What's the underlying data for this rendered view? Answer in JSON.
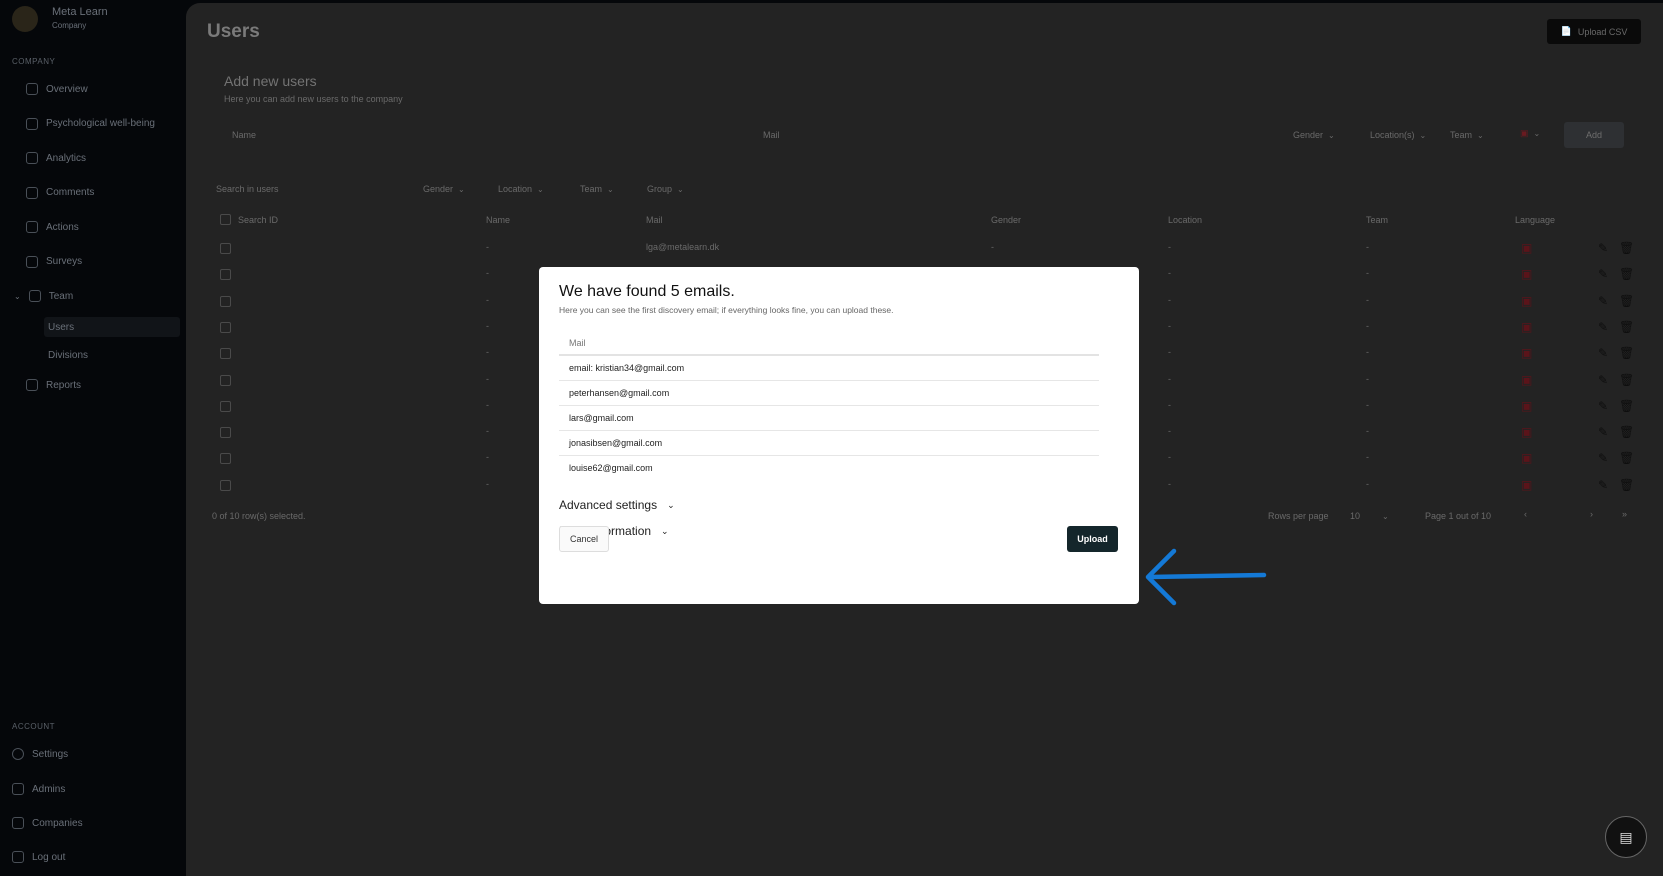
{
  "sidebar": {
    "brand": "Meta Learn",
    "brand_sub": "Company",
    "section1": "Company",
    "items": [
      {
        "label": "Overview",
        "icon": "grid-icon"
      },
      {
        "label": "Psychological well-being",
        "icon": "brain-icon"
      },
      {
        "label": "Analytics",
        "icon": "bar-chart-icon"
      },
      {
        "label": "Comments",
        "icon": "comment-icon"
      },
      {
        "label": "Actions",
        "icon": "check-circle-icon"
      },
      {
        "label": "Surveys",
        "icon": "survey-icon"
      },
      {
        "label": "Team",
        "icon": "team-icon"
      }
    ],
    "sub_items": [
      {
        "label": "Users"
      },
      {
        "label": "Divisions"
      }
    ],
    "reports": "Reports",
    "section2": "Account",
    "account_items": [
      {
        "label": "Settings"
      },
      {
        "label": "Admins"
      },
      {
        "label": "Companies"
      },
      {
        "label": "Log out"
      }
    ]
  },
  "page": {
    "title": "Users",
    "upload_csv": "Upload CSV",
    "add_title": "Add new users",
    "add_sub": "Here you can add new users to the company",
    "name_placeholder": "Name",
    "mail_placeholder": "Mail",
    "gender": "Gender",
    "locations": "Location(s)",
    "team": "Team",
    "add_button": "Add",
    "search_placeholder": "Search in users",
    "filters": [
      "Gender",
      "Location",
      "Team",
      "Group"
    ],
    "columns": [
      "Search ID",
      "Name",
      "Mail",
      "Gender",
      "Location",
      "Team",
      "Language"
    ],
    "first_mail": "lga@metalearn.dk",
    "selected": "0 of 10 row(s) selected.",
    "rows_per_page": "Rows per page",
    "rows_value": "10",
    "page_info": "Page 1 out of 10"
  },
  "modal": {
    "title": "We have found 5 emails.",
    "subtitle": "Here you can see the first discovery email; if everything looks fine, you can upload these.",
    "column": "Mail",
    "emails": [
      "email: kristian34@gmail.com",
      "peterhansen@gmail.com",
      "lars@gmail.com",
      "jonasibsen@gmail.com",
      "louise62@gmail.com"
    ],
    "advanced": "Advanced settings",
    "basic": "Basic information",
    "cancel": "Cancel",
    "upload": "Upload"
  },
  "colors": {
    "annotation_arrow": "#1479d6",
    "upload_button": "#14262b"
  }
}
